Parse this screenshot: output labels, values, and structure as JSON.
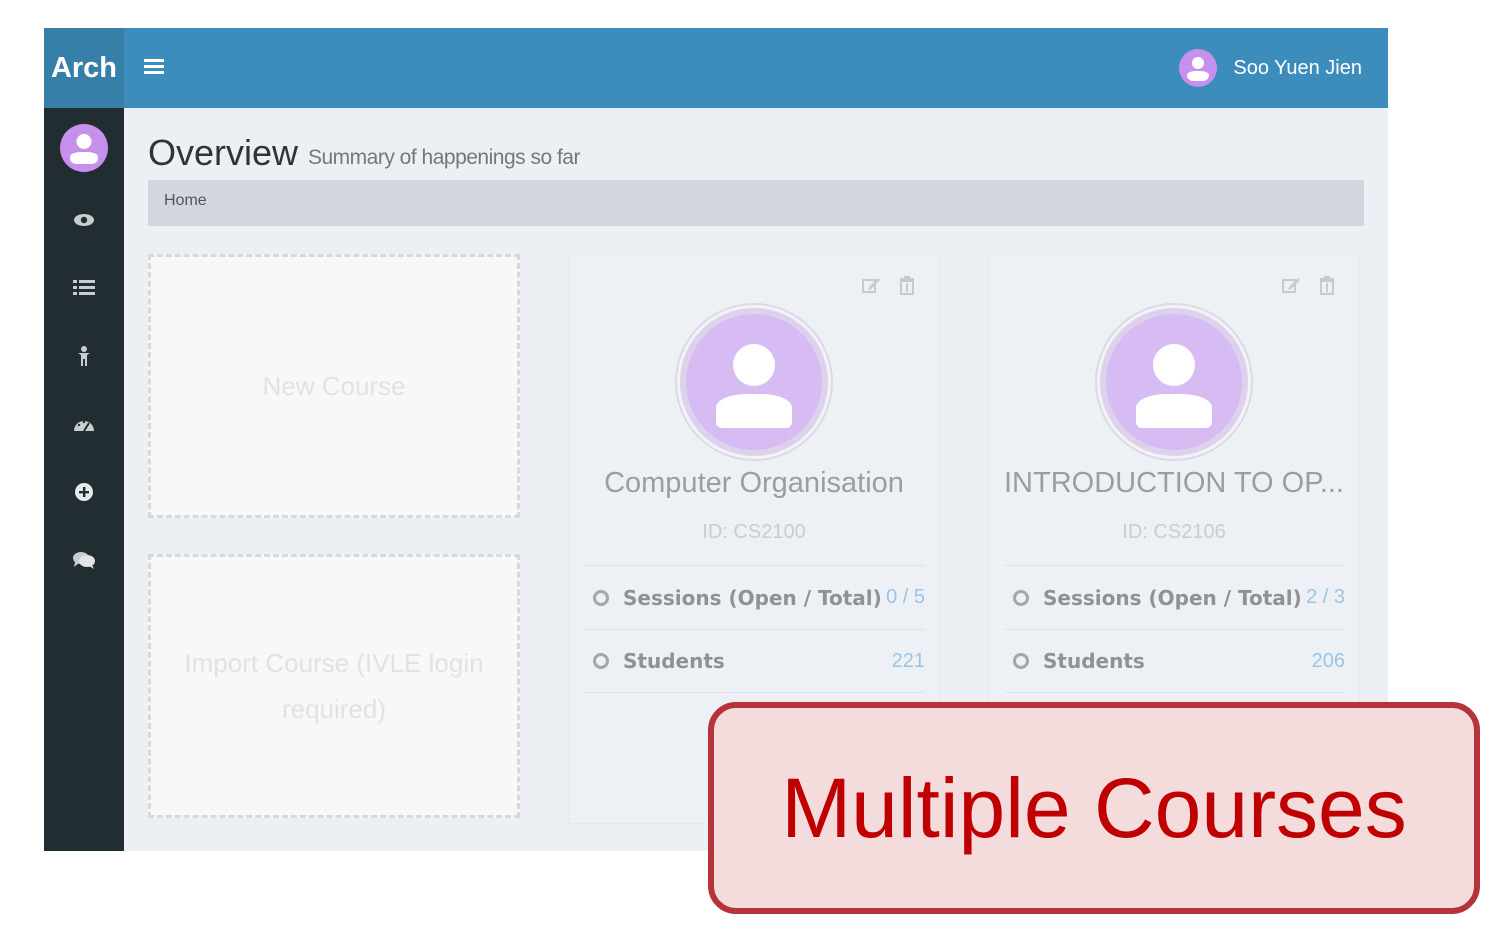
{
  "app": {
    "brand": "Arch"
  },
  "user": {
    "name": "Soo Yuen Jien"
  },
  "header": {
    "title": "Overview",
    "subtitle": "Summary of happenings so far"
  },
  "breadcrumb": {
    "home": "Home"
  },
  "actions": {
    "new_course": "New Course",
    "import_course": "Import Course (IVLE login required)"
  },
  "sidebar": {
    "items": [
      {
        "icon": "eye-icon"
      },
      {
        "icon": "list-icon"
      },
      {
        "icon": "person-icon"
      },
      {
        "icon": "dashboard-icon"
      },
      {
        "icon": "plus-circle-icon"
      },
      {
        "icon": "chat-icon"
      }
    ]
  },
  "courses": [
    {
      "title": "Computer Organisation",
      "id": "ID: CS2100",
      "stats": [
        {
          "label": "Sessions (Open / Total)",
          "value": "0 / 5"
        },
        {
          "label": "Students",
          "value": "221"
        }
      ]
    },
    {
      "title": "INTRODUCTION TO OP...",
      "id": "ID: CS2106",
      "stats": [
        {
          "label": "Sessions (Open / Total)",
          "value": "2 / 3"
        },
        {
          "label": "Students",
          "value": "206"
        }
      ]
    }
  ],
  "callout": {
    "text": "Multiple Courses"
  },
  "colors": {
    "topbar": "#3c8dbc",
    "sidebar": "#222d32",
    "avatar": "#c691ec",
    "callout_text": "#c00000",
    "callout_border": "#b4343a"
  }
}
